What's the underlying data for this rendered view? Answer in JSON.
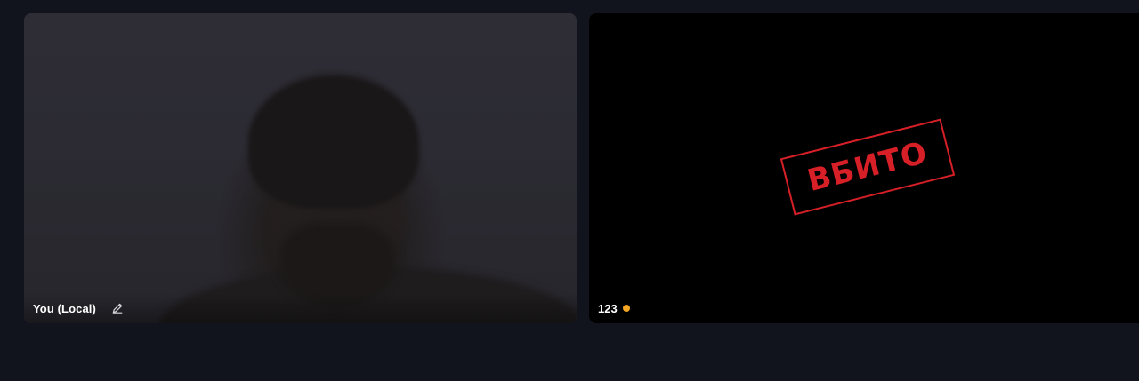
{
  "tiles": {
    "local": {
      "name": "You (Local)",
      "edit_icon": "pencil-icon"
    },
    "remote": {
      "name": "123",
      "status_color": "#f5a623",
      "stamp_text": "ВБИТО",
      "stamp_color": "#d61f26"
    }
  },
  "colors": {
    "background": "#11141c",
    "remote_tile": "#000000"
  }
}
